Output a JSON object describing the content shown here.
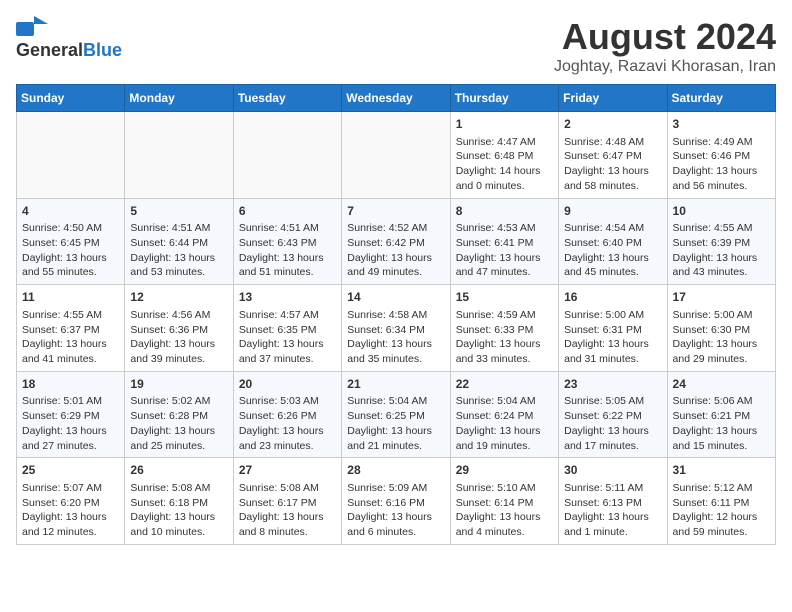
{
  "header": {
    "logo_general": "General",
    "logo_blue": "Blue",
    "month_year": "August 2024",
    "location": "Joghtay, Razavi Khorasan, Iran"
  },
  "weekdays": [
    "Sunday",
    "Monday",
    "Tuesday",
    "Wednesday",
    "Thursday",
    "Friday",
    "Saturday"
  ],
  "weeks": [
    [
      {
        "day": "",
        "info": ""
      },
      {
        "day": "",
        "info": ""
      },
      {
        "day": "",
        "info": ""
      },
      {
        "day": "",
        "info": ""
      },
      {
        "day": "1",
        "info": "Sunrise: 4:47 AM\nSunset: 6:48 PM\nDaylight: 14 hours\nand 0 minutes."
      },
      {
        "day": "2",
        "info": "Sunrise: 4:48 AM\nSunset: 6:47 PM\nDaylight: 13 hours\nand 58 minutes."
      },
      {
        "day": "3",
        "info": "Sunrise: 4:49 AM\nSunset: 6:46 PM\nDaylight: 13 hours\nand 56 minutes."
      }
    ],
    [
      {
        "day": "4",
        "info": "Sunrise: 4:50 AM\nSunset: 6:45 PM\nDaylight: 13 hours\nand 55 minutes."
      },
      {
        "day": "5",
        "info": "Sunrise: 4:51 AM\nSunset: 6:44 PM\nDaylight: 13 hours\nand 53 minutes."
      },
      {
        "day": "6",
        "info": "Sunrise: 4:51 AM\nSunset: 6:43 PM\nDaylight: 13 hours\nand 51 minutes."
      },
      {
        "day": "7",
        "info": "Sunrise: 4:52 AM\nSunset: 6:42 PM\nDaylight: 13 hours\nand 49 minutes."
      },
      {
        "day": "8",
        "info": "Sunrise: 4:53 AM\nSunset: 6:41 PM\nDaylight: 13 hours\nand 47 minutes."
      },
      {
        "day": "9",
        "info": "Sunrise: 4:54 AM\nSunset: 6:40 PM\nDaylight: 13 hours\nand 45 minutes."
      },
      {
        "day": "10",
        "info": "Sunrise: 4:55 AM\nSunset: 6:39 PM\nDaylight: 13 hours\nand 43 minutes."
      }
    ],
    [
      {
        "day": "11",
        "info": "Sunrise: 4:55 AM\nSunset: 6:37 PM\nDaylight: 13 hours\nand 41 minutes."
      },
      {
        "day": "12",
        "info": "Sunrise: 4:56 AM\nSunset: 6:36 PM\nDaylight: 13 hours\nand 39 minutes."
      },
      {
        "day": "13",
        "info": "Sunrise: 4:57 AM\nSunset: 6:35 PM\nDaylight: 13 hours\nand 37 minutes."
      },
      {
        "day": "14",
        "info": "Sunrise: 4:58 AM\nSunset: 6:34 PM\nDaylight: 13 hours\nand 35 minutes."
      },
      {
        "day": "15",
        "info": "Sunrise: 4:59 AM\nSunset: 6:33 PM\nDaylight: 13 hours\nand 33 minutes."
      },
      {
        "day": "16",
        "info": "Sunrise: 5:00 AM\nSunset: 6:31 PM\nDaylight: 13 hours\nand 31 minutes."
      },
      {
        "day": "17",
        "info": "Sunrise: 5:00 AM\nSunset: 6:30 PM\nDaylight: 13 hours\nand 29 minutes."
      }
    ],
    [
      {
        "day": "18",
        "info": "Sunrise: 5:01 AM\nSunset: 6:29 PM\nDaylight: 13 hours\nand 27 minutes."
      },
      {
        "day": "19",
        "info": "Sunrise: 5:02 AM\nSunset: 6:28 PM\nDaylight: 13 hours\nand 25 minutes."
      },
      {
        "day": "20",
        "info": "Sunrise: 5:03 AM\nSunset: 6:26 PM\nDaylight: 13 hours\nand 23 minutes."
      },
      {
        "day": "21",
        "info": "Sunrise: 5:04 AM\nSunset: 6:25 PM\nDaylight: 13 hours\nand 21 minutes."
      },
      {
        "day": "22",
        "info": "Sunrise: 5:04 AM\nSunset: 6:24 PM\nDaylight: 13 hours\nand 19 minutes."
      },
      {
        "day": "23",
        "info": "Sunrise: 5:05 AM\nSunset: 6:22 PM\nDaylight: 13 hours\nand 17 minutes."
      },
      {
        "day": "24",
        "info": "Sunrise: 5:06 AM\nSunset: 6:21 PM\nDaylight: 13 hours\nand 15 minutes."
      }
    ],
    [
      {
        "day": "25",
        "info": "Sunrise: 5:07 AM\nSunset: 6:20 PM\nDaylight: 13 hours\nand 12 minutes."
      },
      {
        "day": "26",
        "info": "Sunrise: 5:08 AM\nSunset: 6:18 PM\nDaylight: 13 hours\nand 10 minutes."
      },
      {
        "day": "27",
        "info": "Sunrise: 5:08 AM\nSunset: 6:17 PM\nDaylight: 13 hours\nand 8 minutes."
      },
      {
        "day": "28",
        "info": "Sunrise: 5:09 AM\nSunset: 6:16 PM\nDaylight: 13 hours\nand 6 minutes."
      },
      {
        "day": "29",
        "info": "Sunrise: 5:10 AM\nSunset: 6:14 PM\nDaylight: 13 hours\nand 4 minutes."
      },
      {
        "day": "30",
        "info": "Sunrise: 5:11 AM\nSunset: 6:13 PM\nDaylight: 13 hours\nand 1 minute."
      },
      {
        "day": "31",
        "info": "Sunrise: 5:12 AM\nSunset: 6:11 PM\nDaylight: 12 hours\nand 59 minutes."
      }
    ]
  ]
}
